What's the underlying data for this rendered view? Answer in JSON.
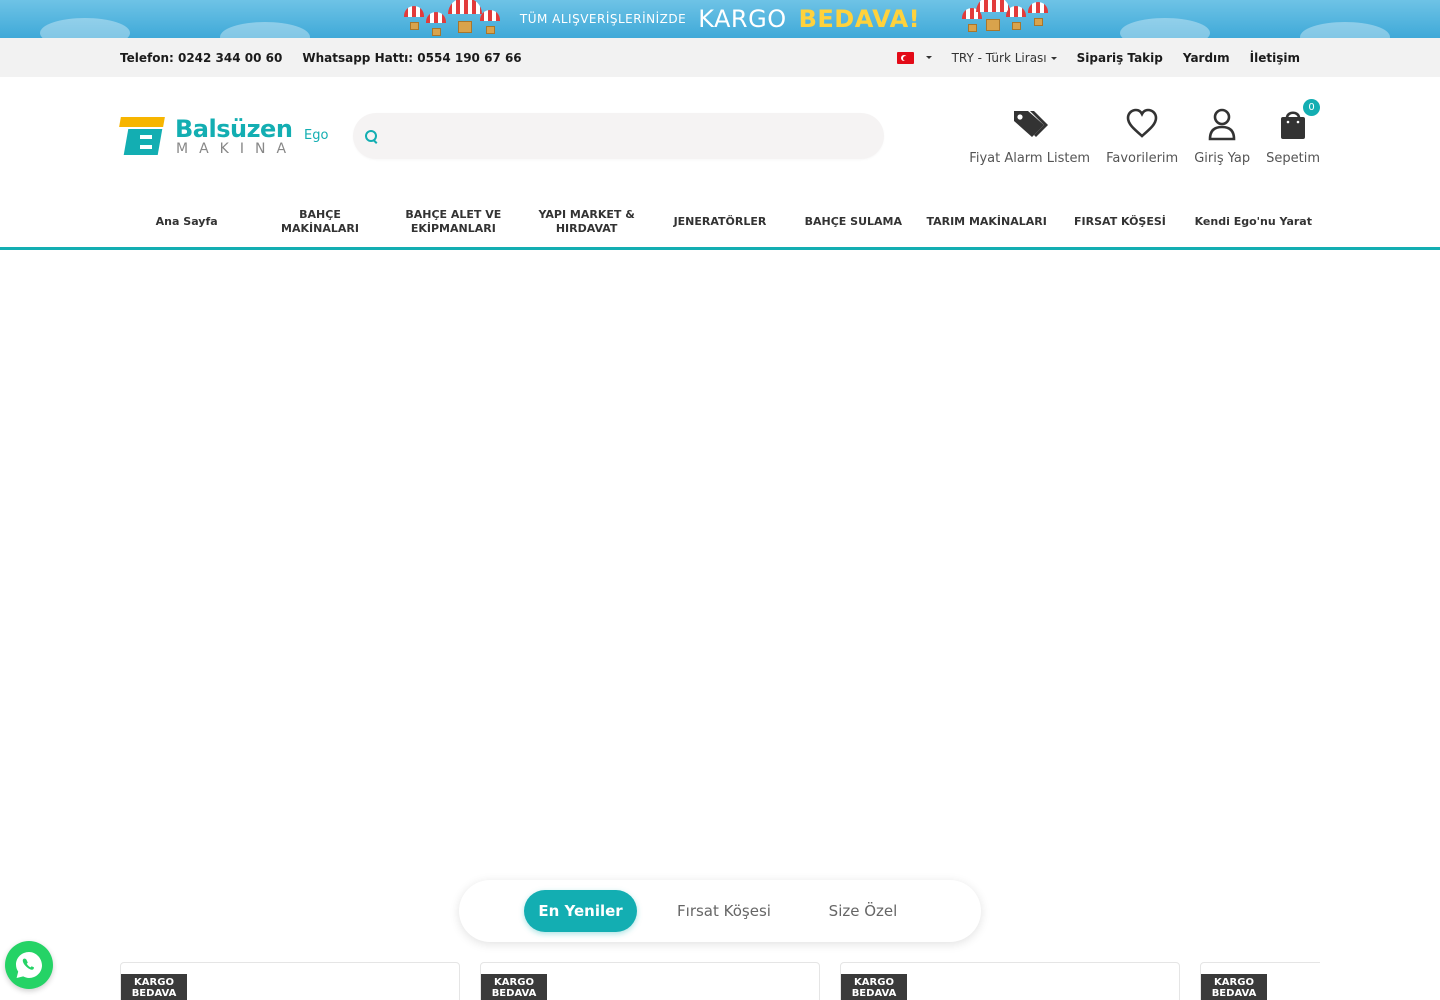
{
  "promo": {
    "small_text": "TÜM ALIŞVERİŞLERİNİZDE",
    "big_text": "KARGO",
    "accent_text": "BEDAVA!",
    "colors": {
      "background": "#3fa9d8",
      "accent": "#ffd23c"
    }
  },
  "topbar": {
    "phone": "Telefon: 0242 344 00 60",
    "whatsapp": "Whatsapp Hattı: 0554 190 67 66",
    "language_flag_icon": "turkey-flag-icon",
    "currency": "TRY - Türk Lirası",
    "links": [
      "Sipariş Takip",
      "Yardım",
      "İletişim"
    ]
  },
  "header": {
    "logo": {
      "name": "Balsüzen",
      "sub": "MAKINA",
      "ego": "Ego"
    },
    "search": {
      "placeholder": "",
      "value": ""
    },
    "icons": [
      {
        "label": "Fiyat Alarm Listem",
        "icon": "price-tag-icon"
      },
      {
        "label": "Favorilerim",
        "icon": "heart-icon"
      },
      {
        "label": "Giriş Yap",
        "icon": "user-icon"
      },
      {
        "label": "Sepetim",
        "icon": "shopping-bag-icon",
        "badge": "0"
      }
    ]
  },
  "nav": {
    "items": [
      "Ana Sayfa",
      "BAHÇE MAKİNALARI",
      "BAHÇE ALET VE EKİPMANLARI",
      "YAPI MARKET & HIRDAVAT",
      "JENERATÖRLER",
      "BAHÇE SULAMA",
      "TARIM MAKİNALARI",
      "FIRSAT KÖŞESİ",
      "Kendi Ego'nu Yarat"
    ]
  },
  "tabs": {
    "items": [
      "En Yeniler",
      "Fırsat Köşesi",
      "Size Özel"
    ],
    "active_index": 0
  },
  "cards": {
    "badge_line1": "KARGO",
    "badge_line2": "BEDAVA"
  },
  "colors": {
    "brand": "#13aeb2",
    "brand_yellow": "#f7b500",
    "whatsapp": "#25d366"
  }
}
